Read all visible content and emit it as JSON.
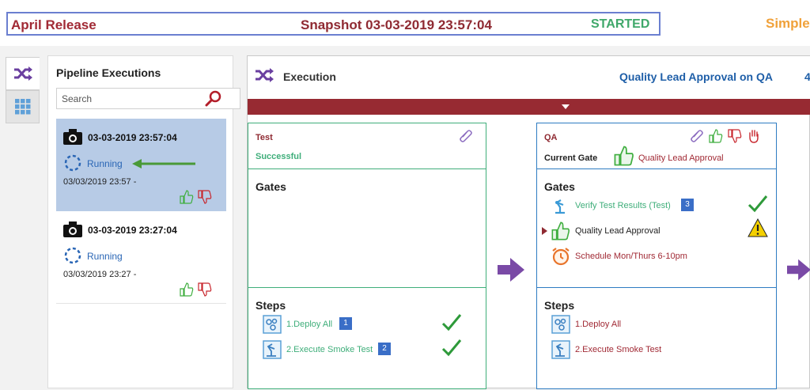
{
  "header": {
    "release": "April Release",
    "snapshot": "Snapshot 03-03-2019 23:57:04",
    "status": "STARTED",
    "right_label": "Simple"
  },
  "side_tabs": [
    {
      "icon": "shuffle-icon",
      "active": true
    },
    {
      "icon": "grid-icon",
      "active": false
    }
  ],
  "pipeline": {
    "title": "Pipeline Executions",
    "search_placeholder": "Search",
    "executions": [
      {
        "date": "03-03-2019 23:57:04",
        "status": "Running",
        "time": "03/03/2019 23:57  -",
        "selected": true
      },
      {
        "date": "03-03-2019 23:27:04",
        "status": "Running",
        "time": "03/03/2019 23:27  -",
        "selected": false
      }
    ]
  },
  "execution": {
    "title": "Execution",
    "current": "Quality Lead Approval on QA",
    "trailing": "4"
  },
  "stages": {
    "test": {
      "name": "Test",
      "status": "Successful",
      "gates_title": "Gates",
      "steps_title": "Steps",
      "steps": [
        {
          "label": "1.Deploy All",
          "badge": "1",
          "done": true
        },
        {
          "label": "2.Execute Smoke Test",
          "badge": "2",
          "done": true
        }
      ]
    },
    "qa": {
      "name": "QA",
      "current_gate_label": "Current Gate",
      "current_gate": "Quality Lead Approval",
      "gates_title": "Gates",
      "gates": [
        {
          "label": "Verify Test Results (Test)",
          "badge": "3",
          "state": "passed"
        },
        {
          "label": "Quality Lead Approval",
          "state": "warning"
        },
        {
          "label": "Schedule Mon/Thurs 6-10pm",
          "state": "pending"
        }
      ],
      "steps_title": "Steps",
      "steps": [
        {
          "label": "1.Deploy All"
        },
        {
          "label": "2.Execute Smoke Test"
        }
      ]
    }
  },
  "colors": {
    "accent_red": "#972a32",
    "success_green": "#3fae7a",
    "link_blue": "#1f5fa8",
    "purple": "#7a4aa6"
  }
}
